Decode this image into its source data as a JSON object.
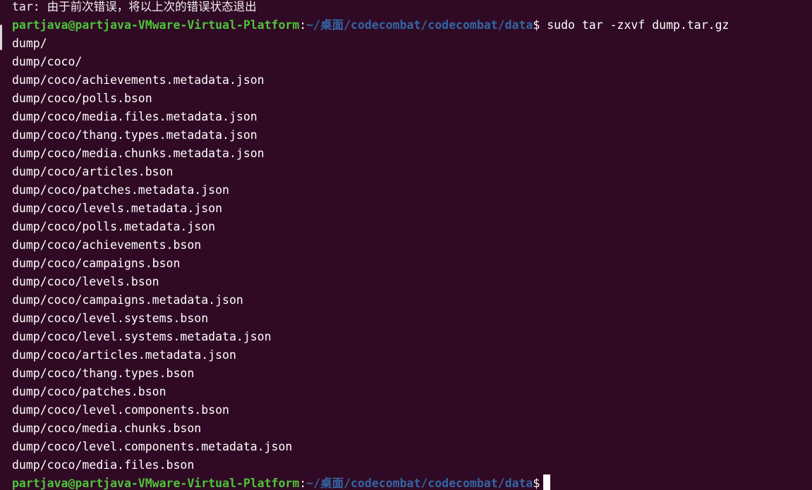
{
  "terminal": {
    "clipped_line": "tar: 由于前次错误，将以上次的错误状态退出",
    "prompt": {
      "user_host": "partjava@partjava-VMware-Virtual-Platform",
      "colon": ":",
      "path": "~/桌面/codecombat/codecombat/data",
      "dollar": "$"
    },
    "command": " sudo tar -zxvf dump.tar.gz",
    "output": [
      "dump/",
      "dump/coco/",
      "dump/coco/achievements.metadata.json",
      "dump/coco/polls.bson",
      "dump/coco/media.files.metadata.json",
      "dump/coco/thang.types.metadata.json",
      "dump/coco/media.chunks.metadata.json",
      "dump/coco/articles.bson",
      "dump/coco/patches.metadata.json",
      "dump/coco/levels.metadata.json",
      "dump/coco/polls.metadata.json",
      "dump/coco/achievements.bson",
      "dump/coco/campaigns.bson",
      "dump/coco/levels.bson",
      "dump/coco/campaigns.metadata.json",
      "dump/coco/level.systems.bson",
      "dump/coco/level.systems.metadata.json",
      "dump/coco/articles.metadata.json",
      "dump/coco/thang.types.bson",
      "dump/coco/patches.bson",
      "dump/coco/level.components.bson",
      "dump/coco/media.chunks.bson",
      "dump/coco/level.components.metadata.json",
      "dump/coco/media.files.bson"
    ],
    "colors": {
      "background": "#300a24",
      "foreground": "#ffffff",
      "prompt_user": "#4ec43a",
      "prompt_path": "#3465a4"
    }
  }
}
